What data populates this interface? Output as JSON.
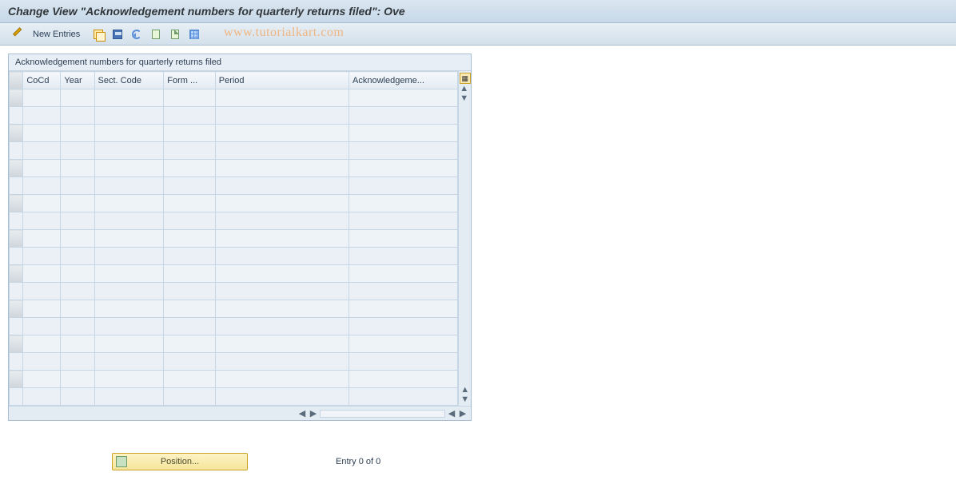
{
  "title": "Change View \"Acknowledgement numbers for quarterly returns filed\": Ove",
  "watermark": "www.tutorialkart.com",
  "toolbar": {
    "new_entries_label": "New Entries"
  },
  "panel": {
    "title": "Acknowledgement numbers for quarterly returns filed",
    "columns": [
      "CoCd",
      "Year",
      "Sect. Code",
      "Form ...",
      "Period",
      "Acknowledgeme..."
    ],
    "row_count": 18
  },
  "footer": {
    "position_label": "Position...",
    "entry_text": "Entry 0 of 0"
  }
}
